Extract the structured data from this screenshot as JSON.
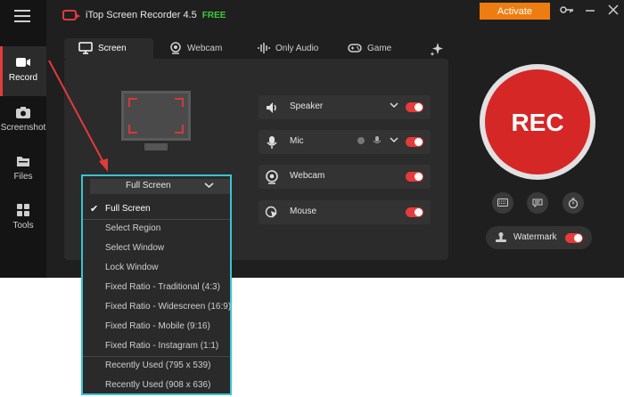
{
  "app": {
    "title": "iTop Screen Recorder 4.5",
    "edition": "FREE",
    "activate_label": "Activate",
    "accent_color": "#e63b3b",
    "activate_color": "#ee7d11"
  },
  "sidebar": {
    "items": [
      {
        "label": "Record",
        "icon": "camera-icon"
      },
      {
        "label": "Screenshot",
        "icon": "photo-camera-icon"
      },
      {
        "label": "Files",
        "icon": "folder-icon"
      },
      {
        "label": "Tools",
        "icon": "grid-icon"
      }
    ]
  },
  "tabs": [
    {
      "label": "Screen",
      "icon": "monitor-icon"
    },
    {
      "label": "Webcam",
      "icon": "webcam-icon"
    },
    {
      "label": "Only Audio",
      "icon": "audio-wave-icon"
    },
    {
      "label": "Game",
      "icon": "gamepad-icon"
    }
  ],
  "sources": [
    {
      "label": "Speaker",
      "icon": "speaker-icon",
      "enabled": true
    },
    {
      "label": "Mic",
      "icon": "mic-icon",
      "enabled": true
    },
    {
      "label": "Webcam",
      "icon": "webcam-icon",
      "enabled": true
    },
    {
      "label": "Mouse",
      "icon": "mouse-icon",
      "enabled": true
    }
  ],
  "rec": {
    "label": "REC",
    "watermark_label": "Watermark",
    "watermark_enabled": true
  },
  "region_dropdown": {
    "selected": "Full Screen",
    "options": [
      "Full Screen",
      "Select Region",
      "Select Window",
      "Lock Window",
      "Fixed Ratio - Traditional (4:3)",
      "Fixed Ratio - Widescreen (16:9)",
      "Fixed Ratio - Mobile (9:16)",
      "Fixed Ratio - Instagram (1:1)",
      "Recently Used (795 x 539)",
      "Recently Used (908 x 636)"
    ]
  }
}
